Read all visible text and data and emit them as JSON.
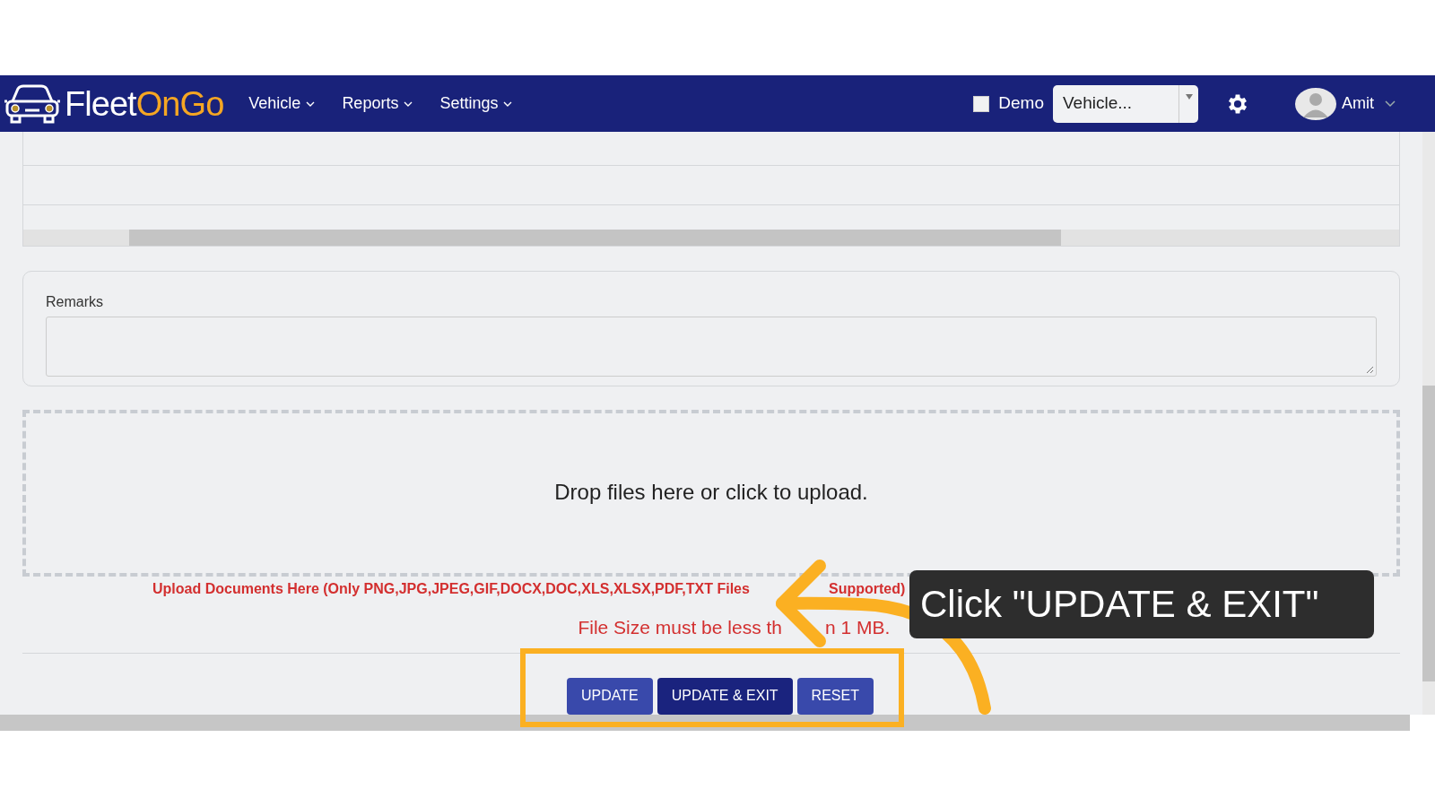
{
  "navbar": {
    "logo": {
      "part_1": "Fleet",
      "part_2": "On",
      "part_3": "Go"
    },
    "menu": [
      {
        "label": "Vehicle"
      },
      {
        "label": "Reports"
      },
      {
        "label": "Settings"
      }
    ],
    "demo": {
      "label": "Demo",
      "checked": false
    },
    "vehicle_select": {
      "value": "Vehicle..."
    },
    "user": {
      "name": "Amit"
    }
  },
  "form": {
    "remarks": {
      "label": "Remarks"
    },
    "dropzone": {
      "message": "Drop files here or click to upload."
    },
    "upload_note": [
      "Upload Documents Here (Only PNG,JPG,JPEG,GIF,DOCX,DOC,XLS,XLSX,PDF,TXT Files",
      "Supported)"
    ],
    "size_note": [
      "File Size must be less th",
      "n 1 MB."
    ],
    "buttons": [
      {
        "label": "UPDATE",
        "kind": "primary"
      },
      {
        "label": "UPDATE & EXIT",
        "kind": "dark"
      },
      {
        "label": "RESET",
        "kind": "primary"
      }
    ]
  },
  "tutorial": {
    "callout": "Click \"UPDATE & EXIT\""
  }
}
